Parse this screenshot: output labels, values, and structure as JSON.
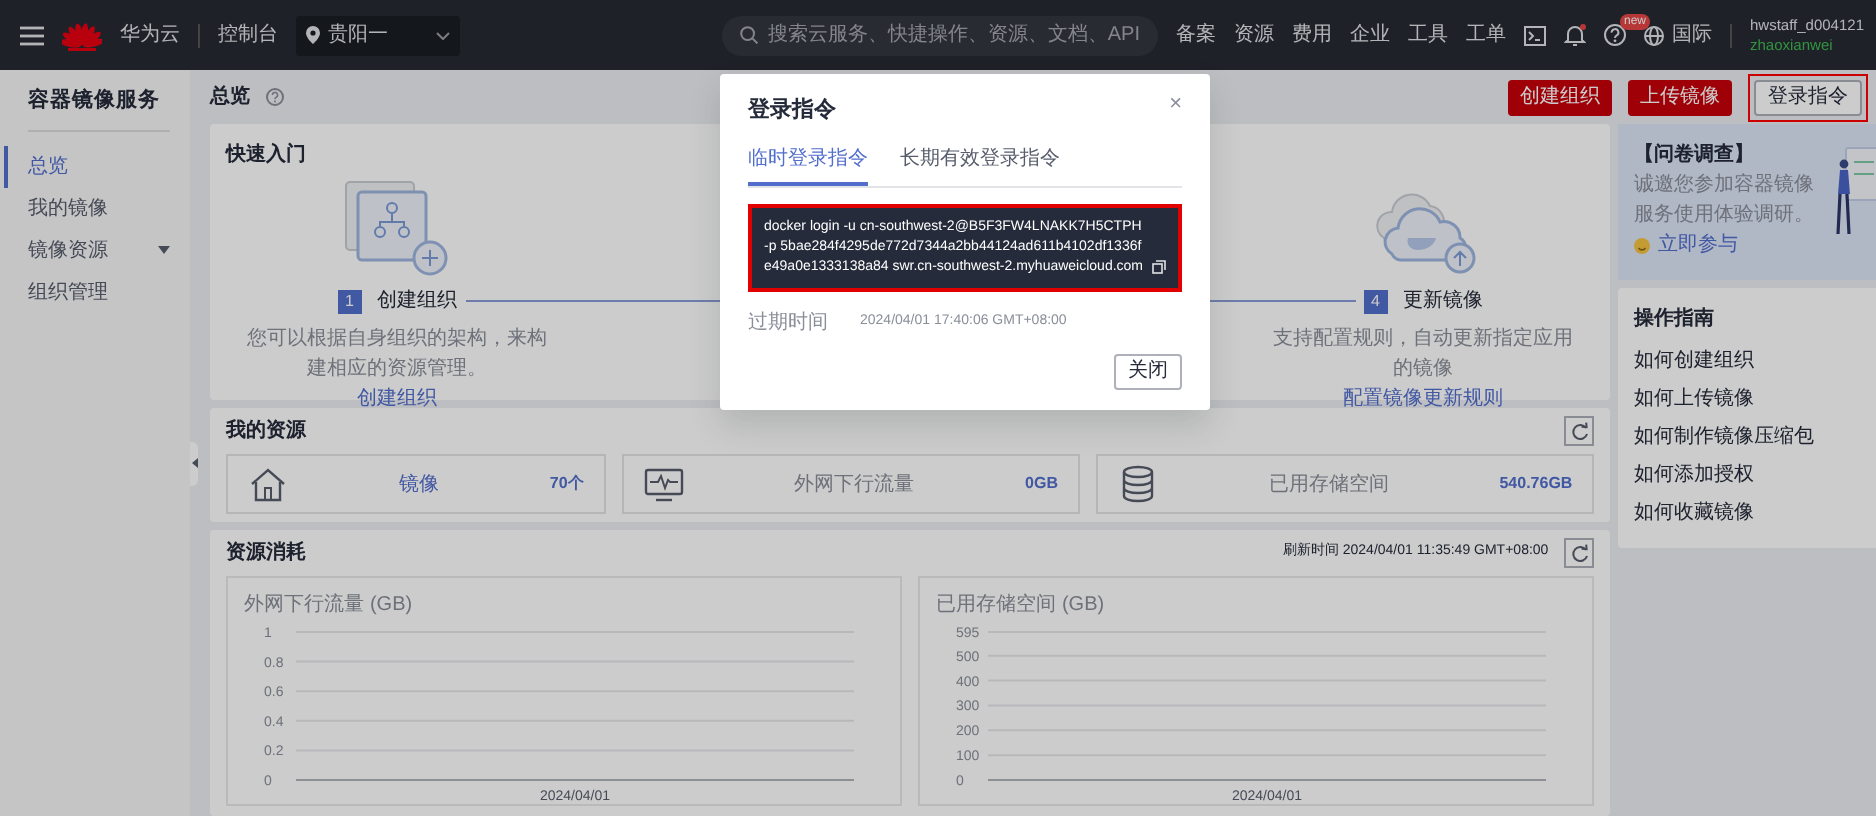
{
  "top_bar": {
    "brand": "华为云",
    "console": "控制台",
    "region": "贵阳一",
    "search_placeholder": "搜索云服务、快捷操作、资源、文档、API",
    "links": [
      "备案",
      "资源",
      "费用",
      "企业",
      "工具",
      "工单"
    ],
    "help_badge": "new",
    "language": "国际",
    "account": "hwstaff_d004121",
    "user_name": "zhaoxianwei"
  },
  "sidebar": {
    "title": "容器镜像服务",
    "items": [
      {
        "label": "总览",
        "selected": true,
        "expandable": false
      },
      {
        "label": "我的镜像",
        "selected": false,
        "expandable": false
      },
      {
        "label": "镜像资源",
        "selected": false,
        "expandable": true
      },
      {
        "label": "组织管理",
        "selected": false,
        "expandable": false
      }
    ]
  },
  "page": {
    "title": "总览",
    "buttons": [
      {
        "label": "创建组织",
        "kind": "primary",
        "highlighted": false
      },
      {
        "label": "上传镜像",
        "kind": "primary",
        "highlighted": false
      },
      {
        "label": "登录指令",
        "kind": "secondary",
        "highlighted": true
      }
    ]
  },
  "quick_start": {
    "title": "快速入门",
    "steps": [
      {
        "number": "1",
        "title": "创建组织",
        "description": "您可以根据自身组织的架构，来构建相应的资源管理。",
        "link": "创建组织",
        "kind": "organization"
      },
      {
        "number": "4",
        "title": "更新镜像",
        "description": "支持配置规则，自动更新指定应用的镜像",
        "link": "配置镜像更新规则",
        "kind": "cloud"
      }
    ]
  },
  "survey": {
    "title": "【问卷调查】",
    "text": "诚邀您参加容器镜像服务使用体验调研。",
    "link": "立即参与"
  },
  "guide": {
    "title": "操作指南",
    "links": [
      "如何创建组织",
      "如何上传镜像",
      "如何制作镜像压缩包",
      "如何添加授权",
      "如何收藏镜像"
    ]
  },
  "resources": {
    "title": "我的资源",
    "tiles": [
      {
        "kind": "image",
        "label": "镜像",
        "value": "70个",
        "label_link": true
      },
      {
        "kind": "traffic",
        "label": "外网下行流量",
        "value": "0GB",
        "label_link": false
      },
      {
        "kind": "storage",
        "label": "已用存储空间",
        "value": "540.76GB",
        "label_link": false
      }
    ]
  },
  "consumption": {
    "title": "资源消耗",
    "refresh_time": "刷新时间 2024/04/01 11:35:49 GMT+08:00",
    "charts": [
      {
        "chart_data": {
          "type": "line",
          "title": "外网下行流量 (GB)",
          "categories": [
            "2024/04/01"
          ],
          "ylim": [
            0,
            1
          ],
          "grid": true,
          "yticks": [
            0,
            0.2,
            0.4,
            0.6,
            0.8,
            1
          ]
        }
      },
      {
        "chart_data": {
          "type": "line",
          "title": "已用存储空间 (GB)",
          "categories": [
            "2024/04/01"
          ],
          "ylim": [
            0,
            595
          ],
          "grid": true,
          "yticks": [
            0,
            100,
            200,
            300,
            400,
            500,
            595
          ]
        }
      }
    ]
  },
  "dialog": {
    "title": "登录指令",
    "close_glyph": "×",
    "tabs": [
      {
        "label": "临时登录指令",
        "selected": true
      },
      {
        "label": "长期有效登录指令",
        "selected": false
      }
    ],
    "command": "docker login -u cn-southwest-2@B5F3FW4LNAKK7H5CTPH -p 5bae284f4295de772d7344a2bb44124ad611b4102df1336fe49a0e1333138a84 swr.cn-southwest-2.myhuaweicloud.com",
    "highlighted": true,
    "expiry_label": "过期时间",
    "expiry": "2024/04/01 17:40:06 GMT+08:00",
    "close_button": "关闭"
  }
}
